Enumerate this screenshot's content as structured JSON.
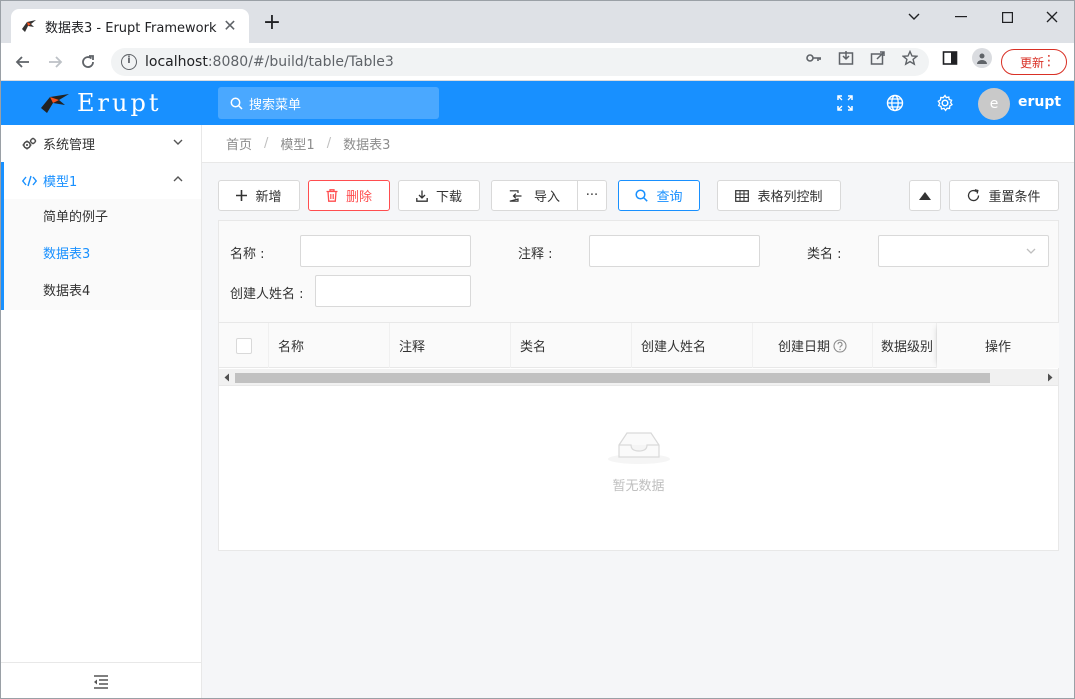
{
  "browser": {
    "tab_title": "数据表3 - Erupt Framework",
    "url_host": "localhost",
    "url_path": ":8080/#/build/table/Table3",
    "update_label": "更新"
  },
  "header": {
    "logo_text": "Erupt",
    "search_placeholder": "搜索菜单",
    "avatar_letter": "e",
    "username": "erupt"
  },
  "sidebar": {
    "groups": [
      {
        "label": "系统管理"
      },
      {
        "label": "模型1"
      }
    ],
    "sub_items": [
      {
        "label": "简单的例子"
      },
      {
        "label": "数据表3"
      },
      {
        "label": "数据表4"
      }
    ]
  },
  "breadcrumb": [
    "首页",
    "模型1",
    "数据表3"
  ],
  "toolbar": {
    "add": "新增",
    "delete": "删除",
    "download": "下载",
    "import": "导入",
    "more": "···",
    "query": "查询",
    "columns": "表格列控制",
    "reset": "重置条件"
  },
  "form": {
    "name_label": "名称 :",
    "note_label": "注释 :",
    "class_label": "类名 :",
    "creator_label": "创建人姓名 :"
  },
  "table": {
    "columns": [
      "名称",
      "注释",
      "类名",
      "创建人姓名",
      "创建日期",
      "数据级别",
      "操作"
    ],
    "empty_text": "暂无数据"
  },
  "colors": {
    "primary": "#1890ff",
    "danger": "#ff4d4f"
  }
}
